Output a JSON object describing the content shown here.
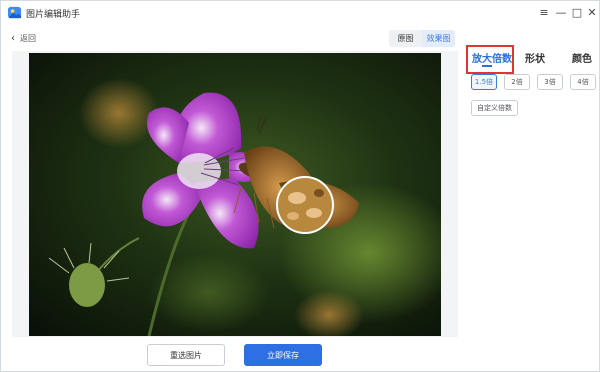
{
  "app": {
    "title": "图片编辑助手",
    "icon": "app-logo-icon"
  },
  "window_controls": {
    "menu": "≡",
    "minimize": "—",
    "maximize": "□",
    "close": "✕"
  },
  "back": {
    "label": "返回",
    "icon": "chevron-left-icon"
  },
  "view_toggle": {
    "tabs": [
      {
        "label": "原图",
        "active": false
      },
      {
        "label": "效果图",
        "active": true
      }
    ]
  },
  "right_panel": {
    "tabs": [
      {
        "label": "放大倍数",
        "active": true
      },
      {
        "label": "形状",
        "active": false
      },
      {
        "label": "颜色",
        "active": false
      }
    ],
    "scale_options": [
      {
        "label": "1.5倍",
        "selected": true
      },
      {
        "label": "2倍",
        "selected": false
      },
      {
        "label": "3倍",
        "selected": false
      },
      {
        "label": "4倍",
        "selected": false
      }
    ],
    "custom_label": "自定义倍数",
    "highlight_color": "#e03535"
  },
  "actions": {
    "reselect_label": "重选图片",
    "save_label": "立即保存"
  },
  "colors": {
    "accent": "#2f6fe4",
    "active_tab": "#2a6fdd"
  }
}
